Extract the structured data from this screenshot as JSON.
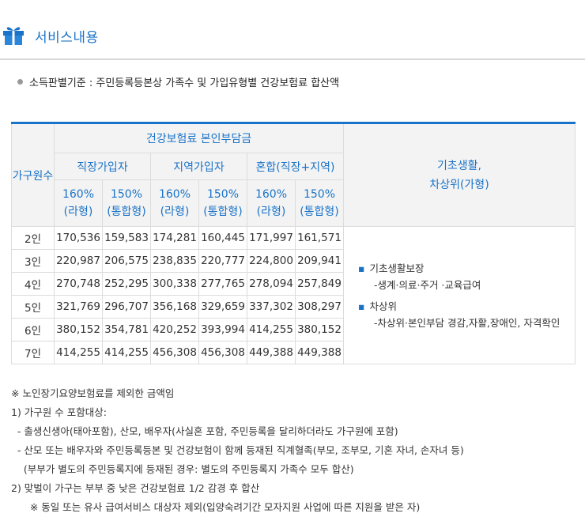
{
  "header": {
    "title": "서비스내용"
  },
  "criteria": "소득판별기준 : 주민등록등본상 가족수 및 가입유형별 건강보험료 합산액",
  "table": {
    "household_header": "가구원수",
    "top_header": "건강보험료 본인부담금",
    "groups": [
      "직장가입자",
      "지역가입자",
      "혼합(직장+지역)"
    ],
    "sub_headers": [
      "160%\n(라형)",
      "150%\n(통합형)",
      "160%\n(라형)",
      "150%\n(통합형)",
      "160%\n(라형)",
      "150%\n(통합형)"
    ],
    "right_header": "기초생활,\n차상위(가형)",
    "rows": [
      {
        "label": "2인",
        "values": [
          "170,536",
          "159,583",
          "174,281",
          "160,445",
          "171,997",
          "161,571"
        ]
      },
      {
        "label": "3인",
        "values": [
          "220,987",
          "206,575",
          "238,835",
          "220,777",
          "224,800",
          "209,941"
        ]
      },
      {
        "label": "4인",
        "values": [
          "270,748",
          "252,295",
          "300,338",
          "277,765",
          "278,094",
          "257,849"
        ]
      },
      {
        "label": "5인",
        "values": [
          "321,769",
          "296,707",
          "356,168",
          "329,659",
          "337,302",
          "308,297"
        ]
      },
      {
        "label": "6인",
        "values": [
          "380,152",
          "354,781",
          "420,252",
          "393,994",
          "414,255",
          "380,152"
        ]
      },
      {
        "label": "7인",
        "values": [
          "414,255",
          "414,255",
          "456,308",
          "456,308",
          "449,388",
          "449,388"
        ]
      }
    ],
    "side": {
      "bullet1": "기초생활보장",
      "sub1": "-생계·의료·주거 ·교육급여",
      "bullet2": "차상위",
      "sub2": "-차상위·본인부담 경감,자활,장애인, 자격확인"
    }
  },
  "notes": [
    "※ 노인장기요양보험료를 제외한 금액임",
    "1) 가구원 수 포함대상:",
    "  - 출생신생아(태아포함), 산모, 배우자(사실혼 포함, 주민등록을 달리하더라도 가구원에 포함)",
    "  - 산모 또는 배우자와 주민등록등본 및 건강보험이 함께 등재된 직계혈족(부모, 조부모, 기혼 자녀, 손자녀 등)",
    "    (부부가 별도의 주민등록지에 등재된 경우: 별도의 주민등록지 가족수 모두 합산)",
    "2) 맞벌이 가구는 부부 중 낮은 건강보험료 1/2 감경 후 합산",
    "      ※ 동일 또는 유사 급여서비스 대상자 제외(입양숙려기간 모자지원 사업에 따른 지원을 받은 자)"
  ],
  "colors": {
    "accent": "#1a73c8",
    "header_bg": "#f3f3f3",
    "border": "#dcdcdc"
  },
  "icons": {
    "header": "gift-box-icon"
  }
}
